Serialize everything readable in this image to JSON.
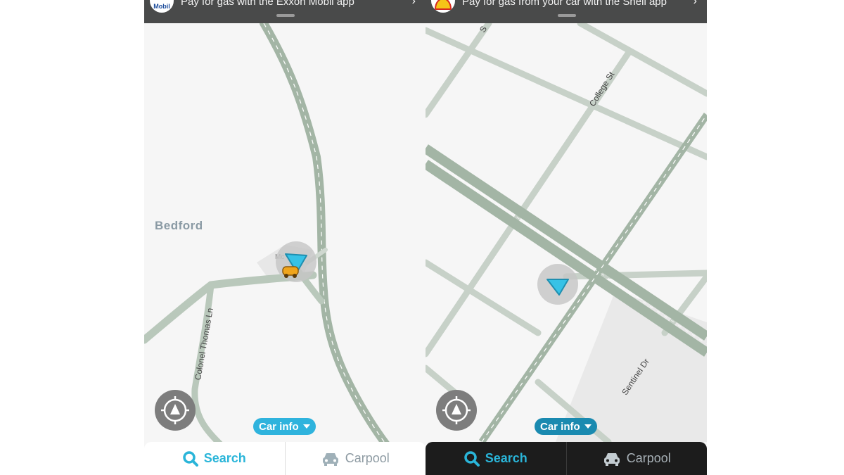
{
  "left_screen": {
    "banner": {
      "logo_text": "Mobil",
      "text": "Pay for gas with the Exxon  Mobil   app"
    },
    "map": {
      "place_name": "Bedford",
      "streets": [
        "Colonel Thomas Ln"
      ],
      "poi_label": "Mc"
    },
    "car_info_label": "Car info",
    "tabs": {
      "search": "Search",
      "carpool": "Carpool"
    },
    "theme": "light"
  },
  "right_screen": {
    "banner": {
      "text": "Pay for gas from your car with the Shell app"
    },
    "map": {
      "streets": [
        "College St",
        "Sentinel Dr",
        "S"
      ]
    },
    "car_info_label": "Car info",
    "tabs": {
      "search": "Search",
      "carpool": "Carpool"
    },
    "theme": "dark"
  },
  "colors": {
    "road": "#b9c8bb",
    "road_major": "#a3b5a5",
    "accent": "#2ab5d9",
    "car_info_light": "#2fb3dd",
    "car_info_dark": "#1a8ab0",
    "banner": "#494a4a"
  }
}
